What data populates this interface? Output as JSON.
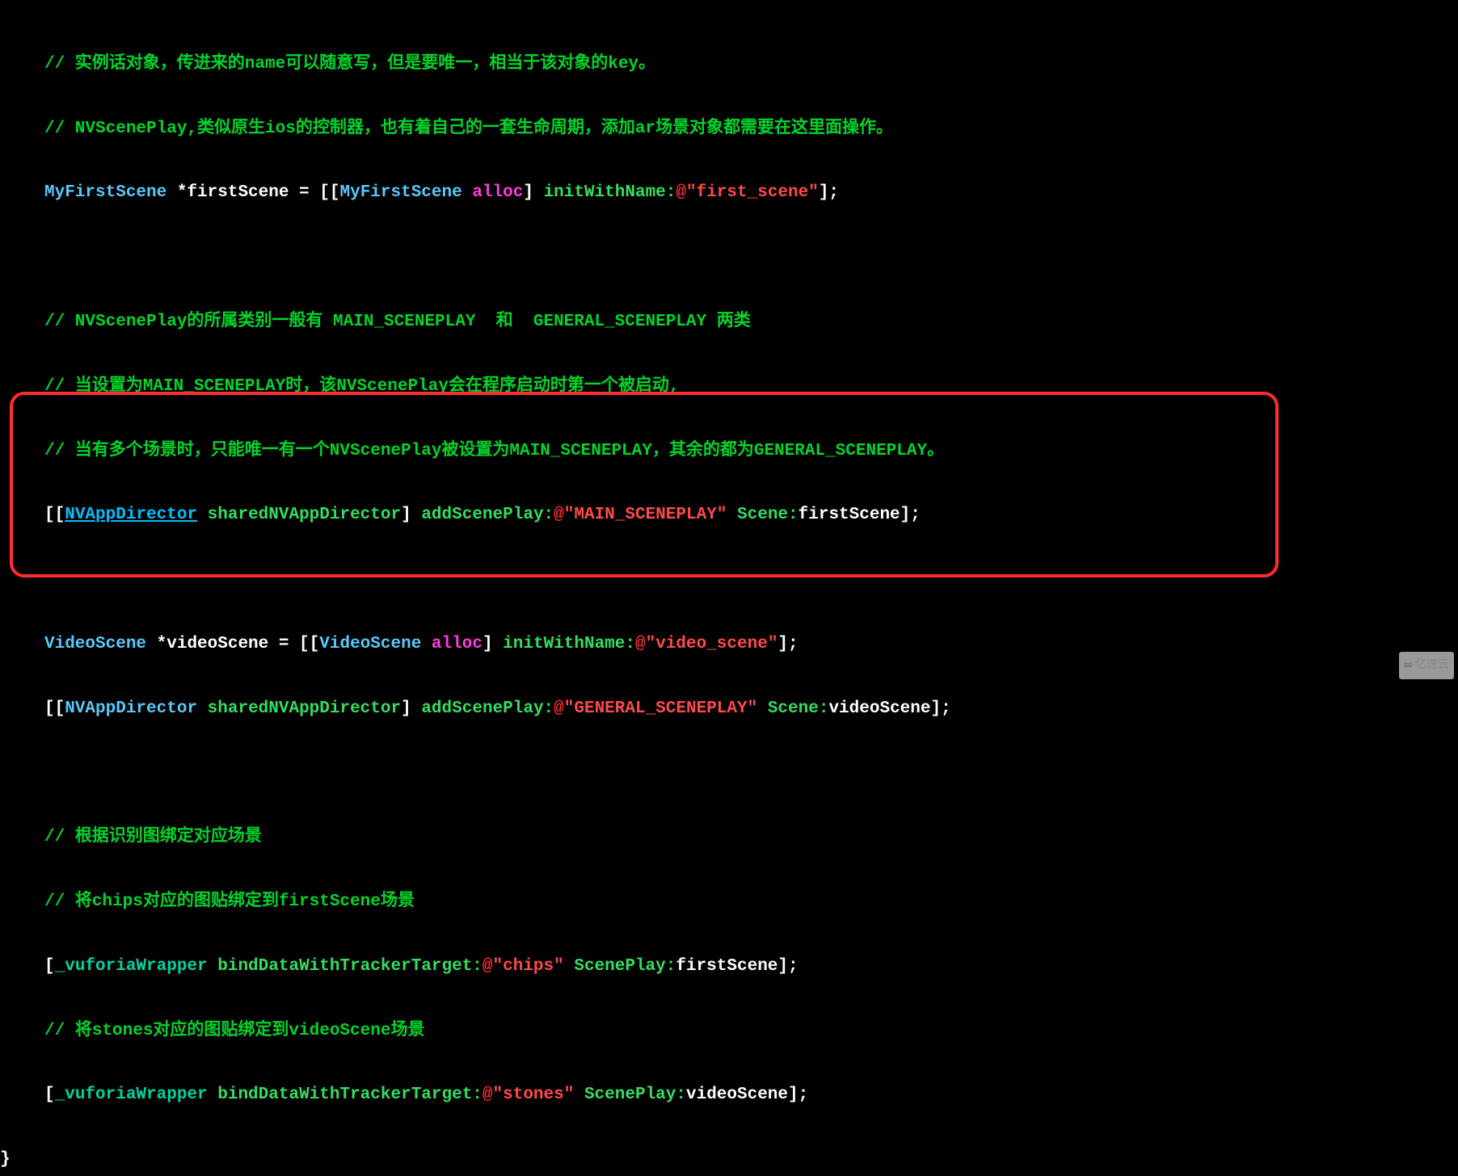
{
  "code": {
    "comment1": "// 实例话对象，传进来的name可以随意写，但是要唯一，相当于该对象的key。",
    "comment2": "// NVScenePlay,类似原生ios的控制器，也有着自己的一套生命周期，添加ar场景对象都需要在这里面操作。",
    "line3": {
      "class1": "MyFirstScene",
      "var": " *firstScene = [[",
      "class2": "MyFirstScene",
      "space": " ",
      "alloc": "alloc",
      "bracket": "] ",
      "method": "initWithName:",
      "at": "@",
      "string": "\"first_scene\"",
      "end": "];"
    },
    "comment4": "// NVScenePlay的所属类别一般有 MAIN_SCENEPLAY  和  GENERAL_SCENEPLAY 两类",
    "comment5": "// 当设置为MAIN_SCENEPLAY时，该NVScenePlay会在程序启动时第一个被启动,",
    "comment6": "// 当有多个场景时，只能唯一有一个NVScenePlay被设置为MAIN_SCENEPLAY，其余的都为GENERAL_SCENEPLAY。",
    "line7": {
      "open": "[[",
      "link": "NVAppDirector",
      "space": " ",
      "method1": "sharedNVAppDirector",
      "bracket1": "] ",
      "method2": "addScenePlay:",
      "at": "@",
      "string": "\"MAIN_SCENEPLAY\"",
      "space2": " ",
      "method3": "Scene:",
      "var": "firstScene];"
    },
    "line8": {
      "class1": "VideoScene",
      "var": " *videoScene = [[",
      "class2": "VideoScene",
      "space": " ",
      "alloc": "alloc",
      "bracket": "] ",
      "method": "initWithName:",
      "at": "@",
      "string": "\"video_scene\"",
      "end": "];"
    },
    "line9": {
      "open": "[[",
      "class": "NVAppDirector",
      "space": " ",
      "method1": "sharedNVAppDirector",
      "bracket1": "] ",
      "method2": "addScenePlay:",
      "at": "@",
      "string": "\"GENERAL_SCENEPLAY\"",
      "space2": " ",
      "method3": "Scene:",
      "var": "videoScene];"
    },
    "comment10": "// 根据识别图绑定对应场景",
    "comment11": "// 将chips对应的图贴绑定到firstScene场景",
    "line12": {
      "open": "[",
      "ivar": "_vuforiaWrapper",
      "space": " ",
      "method1": "bindDataWithTrackerTarget:",
      "at": "@",
      "string": "\"chips\"",
      "space2": " ",
      "method2": "ScenePlay:",
      "var": "firstScene];"
    },
    "comment13": "// 将stones对应的图贴绑定到videoScene场景",
    "line14": {
      "open": "[",
      "ivar": "_vuforiaWrapper",
      "space": " ",
      "method1": "bindDataWithTrackerTarget:",
      "at": "@",
      "string": "\"stones\"",
      "space2": " ",
      "method2": "ScenePlay:",
      "var": "videoScene];"
    },
    "closing_brace": "}"
  },
  "watermark": "亿速云"
}
